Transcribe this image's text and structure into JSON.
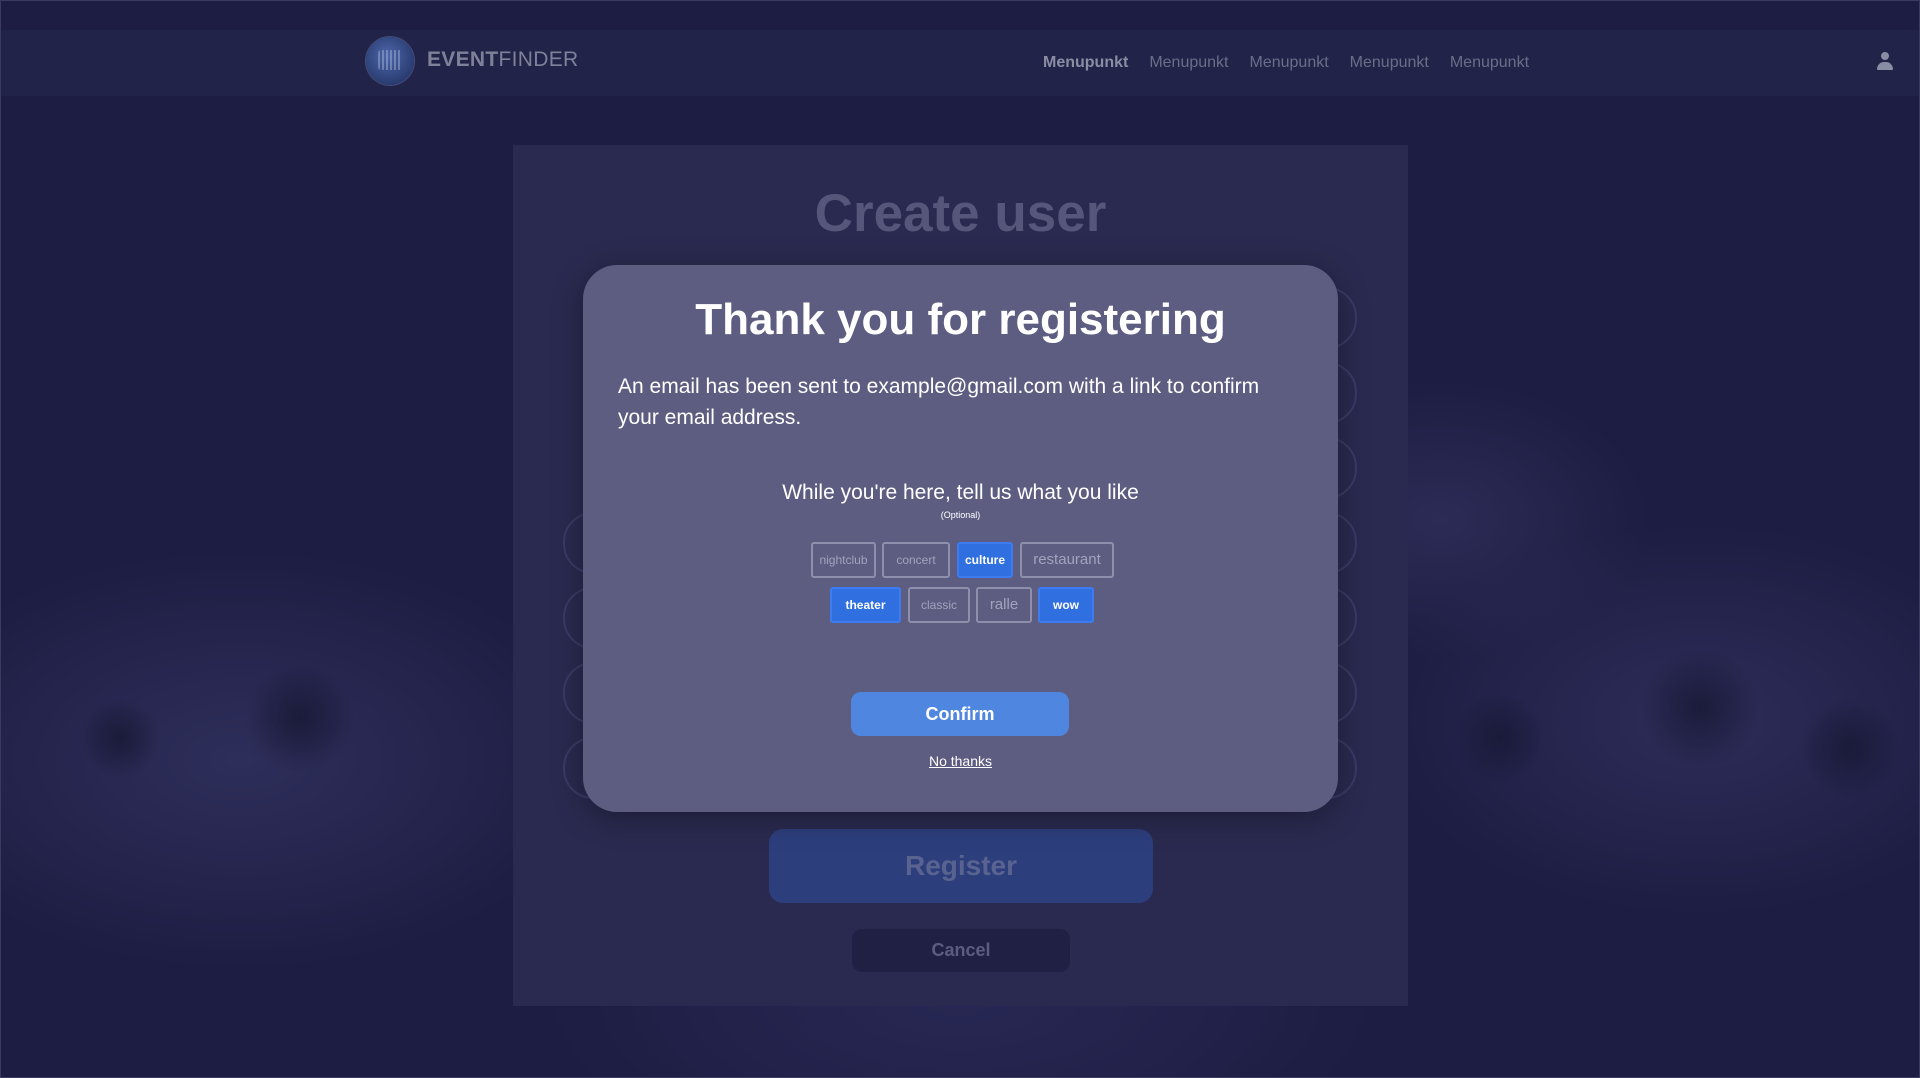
{
  "header": {
    "brand_bold": "EVENT",
    "brand_light": "FINDER",
    "nav": [
      "Menupunkt",
      "Menupunkt",
      "Menupunkt",
      "Menupunkt",
      "Menupunkt"
    ],
    "active_nav_index": 0,
    "account_icon": "user-icon"
  },
  "form": {
    "title": "Create user",
    "register_label": "Register",
    "cancel_label": "Cancel"
  },
  "modal": {
    "title": "Thank you for registering",
    "message": "An email has been sent to example@gmail.com with a link to confirm your email address.",
    "prefs_heading": "While you're here, tell us what you like",
    "optional_note": "(Optional)",
    "tags_row1": [
      {
        "label": "nightclub",
        "selected": false
      },
      {
        "label": "concert",
        "selected": false
      },
      {
        "label": "culture",
        "selected": true
      },
      {
        "label": "restaurant",
        "selected": false
      }
    ],
    "tags_row2": [
      {
        "label": "theater",
        "selected": true
      },
      {
        "label": "classic",
        "selected": false
      },
      {
        "label": "ralle",
        "selected": false
      },
      {
        "label": "wow",
        "selected": true
      }
    ],
    "confirm_label": "Confirm",
    "decline_label": "No thanks"
  },
  "colors": {
    "page_bg": "#1f1f45",
    "modal_bg": "#5d5d82",
    "accent": "#2f6fe0",
    "confirm": "#4f86e0"
  }
}
